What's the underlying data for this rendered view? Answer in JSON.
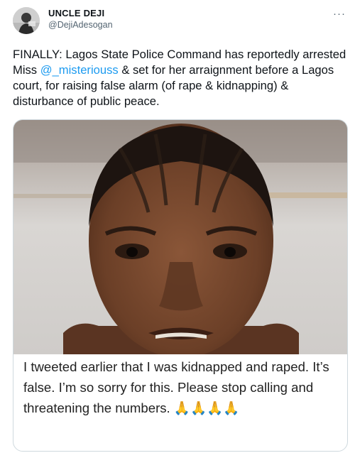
{
  "user": {
    "name": "UNCLE DEJI",
    "handle": "@DejiAdesogan"
  },
  "menu": {
    "more_label": "···"
  },
  "tweet": {
    "text_before": "FINALLY: Lagos State Police Command has reportedly arrested Miss ",
    "mention": "@_misteriouss",
    "text_after": " & set for her arraignment before a Lagos court, for raising false alarm (of rape & kidnapping) & disturbance of public peace."
  },
  "media": {
    "caption": "I tweeted earlier that I was kidnapped and raped. It’s false. I’m so sorry for this. Please stop calling and threatening the numbers. 🙏🙏🙏🙏"
  },
  "colors": {
    "mention": "#1d9bf0",
    "handle": "#536471",
    "border": "#cfd9de"
  }
}
